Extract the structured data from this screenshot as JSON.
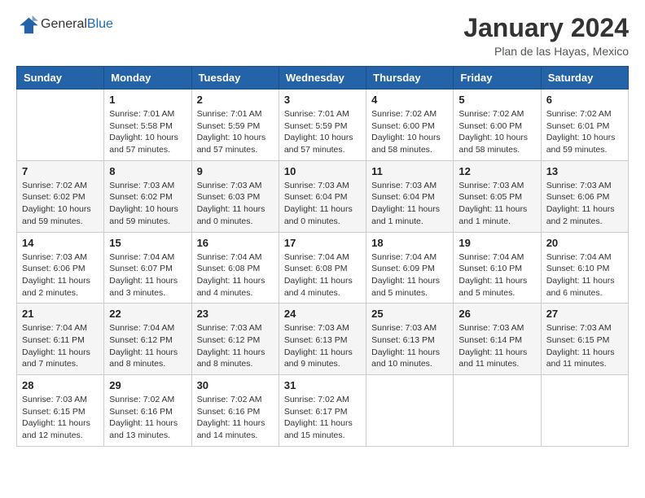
{
  "logo": {
    "general": "General",
    "blue": "Blue"
  },
  "header": {
    "month": "January 2024",
    "location": "Plan de las Hayas, Mexico"
  },
  "weekdays": [
    "Sunday",
    "Monday",
    "Tuesday",
    "Wednesday",
    "Thursday",
    "Friday",
    "Saturday"
  ],
  "weeks": [
    [
      {
        "day": "",
        "info": ""
      },
      {
        "day": "1",
        "info": "Sunrise: 7:01 AM\nSunset: 5:58 PM\nDaylight: 10 hours\nand 57 minutes."
      },
      {
        "day": "2",
        "info": "Sunrise: 7:01 AM\nSunset: 5:59 PM\nDaylight: 10 hours\nand 57 minutes."
      },
      {
        "day": "3",
        "info": "Sunrise: 7:01 AM\nSunset: 5:59 PM\nDaylight: 10 hours\nand 57 minutes."
      },
      {
        "day": "4",
        "info": "Sunrise: 7:02 AM\nSunset: 6:00 PM\nDaylight: 10 hours\nand 58 minutes."
      },
      {
        "day": "5",
        "info": "Sunrise: 7:02 AM\nSunset: 6:00 PM\nDaylight: 10 hours\nand 58 minutes."
      },
      {
        "day": "6",
        "info": "Sunrise: 7:02 AM\nSunset: 6:01 PM\nDaylight: 10 hours\nand 59 minutes."
      }
    ],
    [
      {
        "day": "7",
        "info": "Sunrise: 7:02 AM\nSunset: 6:02 PM\nDaylight: 10 hours\nand 59 minutes."
      },
      {
        "day": "8",
        "info": "Sunrise: 7:03 AM\nSunset: 6:02 PM\nDaylight: 10 hours\nand 59 minutes."
      },
      {
        "day": "9",
        "info": "Sunrise: 7:03 AM\nSunset: 6:03 PM\nDaylight: 11 hours\nand 0 minutes."
      },
      {
        "day": "10",
        "info": "Sunrise: 7:03 AM\nSunset: 6:04 PM\nDaylight: 11 hours\nand 0 minutes."
      },
      {
        "day": "11",
        "info": "Sunrise: 7:03 AM\nSunset: 6:04 PM\nDaylight: 11 hours\nand 1 minute."
      },
      {
        "day": "12",
        "info": "Sunrise: 7:03 AM\nSunset: 6:05 PM\nDaylight: 11 hours\nand 1 minute."
      },
      {
        "day": "13",
        "info": "Sunrise: 7:03 AM\nSunset: 6:06 PM\nDaylight: 11 hours\nand 2 minutes."
      }
    ],
    [
      {
        "day": "14",
        "info": "Sunrise: 7:03 AM\nSunset: 6:06 PM\nDaylight: 11 hours\nand 2 minutes."
      },
      {
        "day": "15",
        "info": "Sunrise: 7:04 AM\nSunset: 6:07 PM\nDaylight: 11 hours\nand 3 minutes."
      },
      {
        "day": "16",
        "info": "Sunrise: 7:04 AM\nSunset: 6:08 PM\nDaylight: 11 hours\nand 4 minutes."
      },
      {
        "day": "17",
        "info": "Sunrise: 7:04 AM\nSunset: 6:08 PM\nDaylight: 11 hours\nand 4 minutes."
      },
      {
        "day": "18",
        "info": "Sunrise: 7:04 AM\nSunset: 6:09 PM\nDaylight: 11 hours\nand 5 minutes."
      },
      {
        "day": "19",
        "info": "Sunrise: 7:04 AM\nSunset: 6:10 PM\nDaylight: 11 hours\nand 5 minutes."
      },
      {
        "day": "20",
        "info": "Sunrise: 7:04 AM\nSunset: 6:10 PM\nDaylight: 11 hours\nand 6 minutes."
      }
    ],
    [
      {
        "day": "21",
        "info": "Sunrise: 7:04 AM\nSunset: 6:11 PM\nDaylight: 11 hours\nand 7 minutes."
      },
      {
        "day": "22",
        "info": "Sunrise: 7:04 AM\nSunset: 6:12 PM\nDaylight: 11 hours\nand 8 minutes."
      },
      {
        "day": "23",
        "info": "Sunrise: 7:03 AM\nSunset: 6:12 PM\nDaylight: 11 hours\nand 8 minutes."
      },
      {
        "day": "24",
        "info": "Sunrise: 7:03 AM\nSunset: 6:13 PM\nDaylight: 11 hours\nand 9 minutes."
      },
      {
        "day": "25",
        "info": "Sunrise: 7:03 AM\nSunset: 6:13 PM\nDaylight: 11 hours\nand 10 minutes."
      },
      {
        "day": "26",
        "info": "Sunrise: 7:03 AM\nSunset: 6:14 PM\nDaylight: 11 hours\nand 11 minutes."
      },
      {
        "day": "27",
        "info": "Sunrise: 7:03 AM\nSunset: 6:15 PM\nDaylight: 11 hours\nand 11 minutes."
      }
    ],
    [
      {
        "day": "28",
        "info": "Sunrise: 7:03 AM\nSunset: 6:15 PM\nDaylight: 11 hours\nand 12 minutes."
      },
      {
        "day": "29",
        "info": "Sunrise: 7:02 AM\nSunset: 6:16 PM\nDaylight: 11 hours\nand 13 minutes."
      },
      {
        "day": "30",
        "info": "Sunrise: 7:02 AM\nSunset: 6:16 PM\nDaylight: 11 hours\nand 14 minutes."
      },
      {
        "day": "31",
        "info": "Sunrise: 7:02 AM\nSunset: 6:17 PM\nDaylight: 11 hours\nand 15 minutes."
      },
      {
        "day": "",
        "info": ""
      },
      {
        "day": "",
        "info": ""
      },
      {
        "day": "",
        "info": ""
      }
    ]
  ]
}
